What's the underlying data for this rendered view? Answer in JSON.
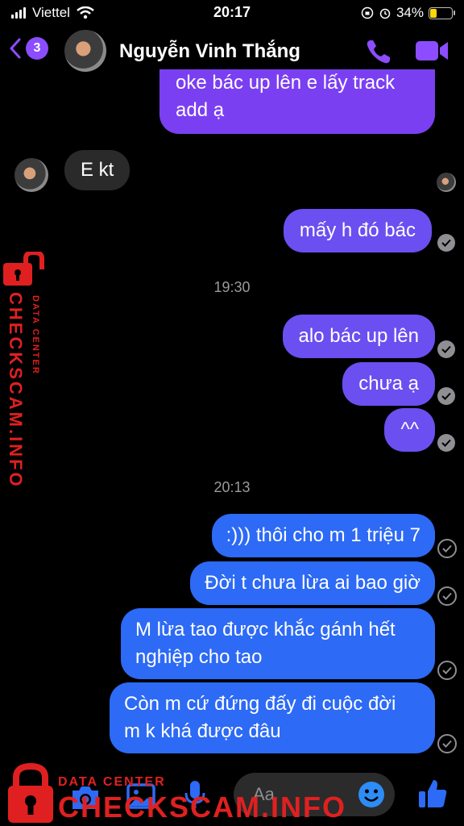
{
  "status_bar": {
    "carrier": "Viettel",
    "time": "20:17",
    "battery": "34%",
    "battery_level": 0.34,
    "battery_color": "#ffd60a"
  },
  "header": {
    "back_badge": "3",
    "contact_name": "Nguyễn Vinh Thắng",
    "accent_color": "#8b4dff",
    "icons": [
      "back-chevron-icon",
      "phone-icon",
      "video-camera-icon"
    ]
  },
  "messages": [
    {
      "sender": "me",
      "text": "oke bác up lên e lấy track",
      "text2": "add ạ"
    },
    {
      "sender": "them",
      "text": "E kt"
    },
    {
      "sender": "me",
      "text": "mấy h đó bác"
    },
    {
      "timestamp": "19:30"
    },
    {
      "sender": "me",
      "text": "alo bác up lên"
    },
    {
      "sender": "me",
      "text": "chưa ạ"
    },
    {
      "sender": "me",
      "text": "^^"
    },
    {
      "timestamp": "20:13"
    },
    {
      "sender": "me",
      "text": ":))) thôi cho m 1 triệu 7"
    },
    {
      "sender": "me",
      "text": "Đời t chưa lừa ai bao giờ"
    },
    {
      "sender": "me",
      "text": "M lừa tao được khắc gánh hết",
      "text2": "nghiệp cho tao"
    },
    {
      "sender": "me",
      "text": "Còn m cứ đứng đấy đi cuộc đời",
      "text2": "m k khá được đâu"
    }
  ],
  "watermark": {
    "small": "DATA CENTER",
    "big": "CHECKSCAM.INFO",
    "color": "#e02020"
  },
  "composer": {
    "placeholder": "Aa",
    "icons": [
      "camera-icon",
      "image-icon",
      "microphone-icon",
      "emoji-icon",
      "thumbs-up-icon"
    ]
  }
}
